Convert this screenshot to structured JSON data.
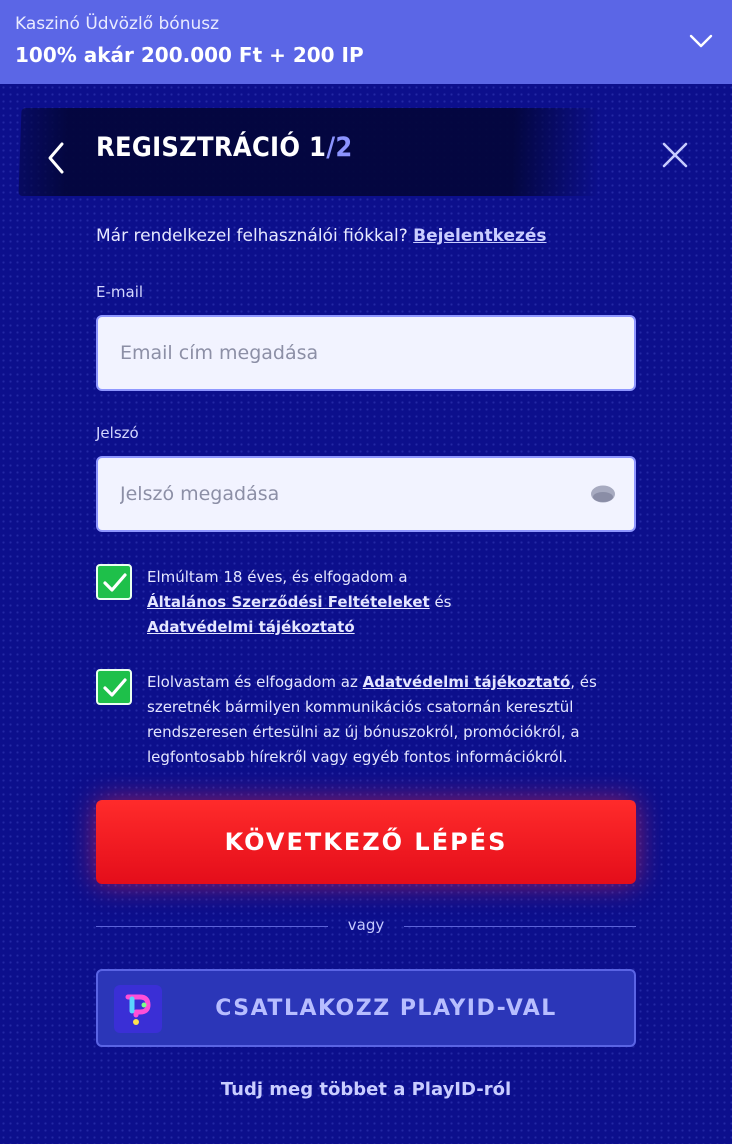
{
  "promo": {
    "label": "Kaszinó Üdvözlő bónusz",
    "value": "100% akár 200.000 Ft + 200 IP"
  },
  "header": {
    "title": "REGISZTRÁCIÓ 1",
    "step_separator": "/",
    "step_total": "2"
  },
  "login": {
    "text": "Már rendelkezel felhasználói fiókkal?",
    "link": "Bejelentkezés"
  },
  "email": {
    "label": "E-mail",
    "placeholder": "Email cím megadása",
    "value": ""
  },
  "password": {
    "label": "Jelszó",
    "placeholder": "Jelszó megadása",
    "value": ""
  },
  "consent1": {
    "checked": true,
    "text_before": "Elmúltam 18 éves, és elfogadom a",
    "link_terms": "Általános Szerződési Feltételeket",
    "text_and": "és",
    "link_privacy": "Adatvédelmi tájékoztató"
  },
  "consent2": {
    "checked": true,
    "text_before": "Elolvastam és elfogadom az",
    "link_privacy": "Adatvédelmi tájékoztató",
    "text_after": ", és szeretnék bármilyen kommunikációs csatornán keresztül rendszeresen értesülni az új bónuszokról, promóciókról, a legfontosabb hírekről vagy egyéb fontos információkról."
  },
  "next_button": "KÖVETKEZŐ LÉPÉS",
  "divider": "vagy",
  "playid_button": "CSATLAKOZZ PLAYID-VAL",
  "learn_more": "Tudj meg többet a PlayID-ról",
  "colors": {
    "background": "#0c0f8c",
    "promo_bar": "#5b66e6",
    "primary_button": "#e40d1a",
    "checkbox": "#1ec04a"
  }
}
